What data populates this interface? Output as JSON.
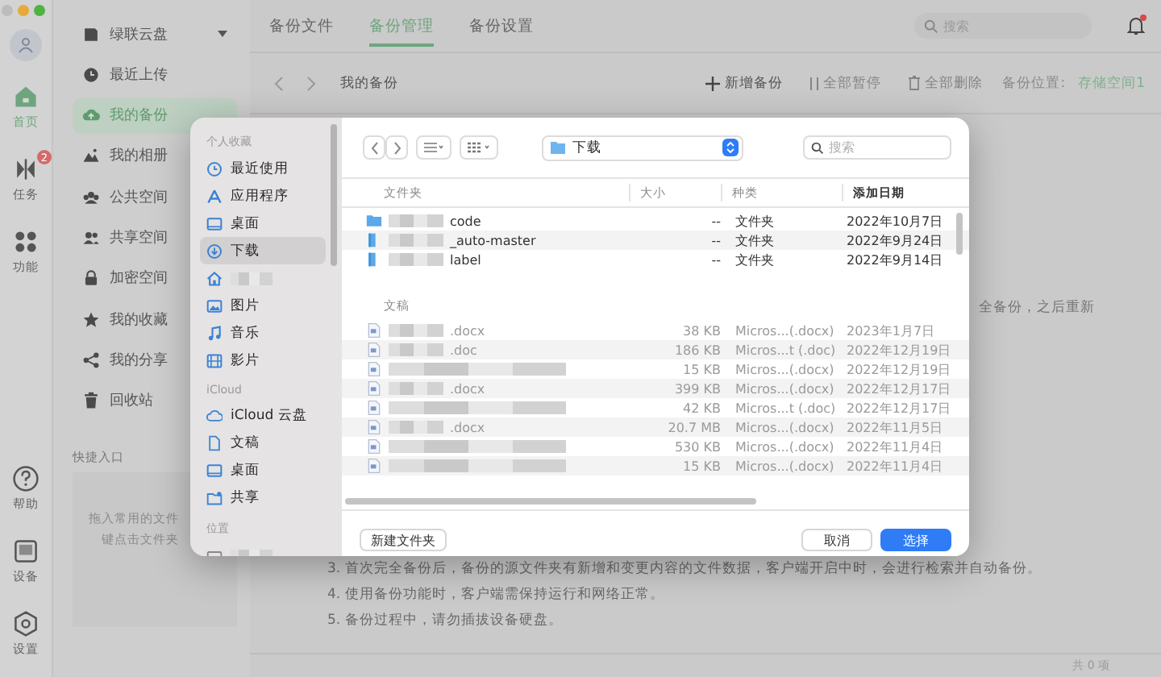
{
  "rail": {
    "items": [
      {
        "label": "首页",
        "kind": "home",
        "selected": true
      },
      {
        "label": "任务",
        "kind": "tasks",
        "badge": "2",
        "selected": false
      },
      {
        "label": "功能",
        "kind": "apps",
        "selected": false
      }
    ],
    "bottom": [
      {
        "label": "帮助",
        "kind": "help"
      },
      {
        "label": "设备",
        "kind": "device"
      },
      {
        "label": "设置",
        "kind": "settings"
      }
    ]
  },
  "sidebar": {
    "items": [
      {
        "label": "绿联云盘",
        "kind": "drive",
        "dropdown": true,
        "selected": false
      },
      {
        "label": "最近上传",
        "kind": "recent",
        "selected": false
      },
      {
        "label": "我的备份",
        "kind": "backup",
        "selected": true
      },
      {
        "label": "我的相册",
        "kind": "album",
        "selected": false
      },
      {
        "label": "公共空间",
        "kind": "public",
        "selected": false
      },
      {
        "label": "共享空间",
        "kind": "shared",
        "selected": false
      },
      {
        "label": "加密空间",
        "kind": "lock",
        "selected": false
      },
      {
        "label": "我的收藏",
        "kind": "star",
        "selected": false
      },
      {
        "label": "我的分享",
        "kind": "share",
        "selected": false
      },
      {
        "label": "回收站",
        "kind": "trash",
        "selected": false
      }
    ],
    "quick_access": {
      "title": "快捷入口",
      "hint_lines": [
        "拖入常用的文件",
        "键点击文件夹"
      ]
    }
  },
  "tabs": [
    {
      "label": "备份文件",
      "selected": false
    },
    {
      "label": "备份管理",
      "selected": true
    },
    {
      "label": "备份设置",
      "selected": false
    }
  ],
  "search": {
    "placeholder": "搜索"
  },
  "notifications": {
    "unread": true
  },
  "toolbar": {
    "breadcrumb": "我的备份",
    "actions": [
      {
        "label": "新增备份",
        "kind": "add",
        "disabled": false
      },
      {
        "label": "全部暂停",
        "kind": "pause",
        "disabled": true
      },
      {
        "label": "全部删除",
        "kind": "delete",
        "disabled": true
      }
    ],
    "location_label": "备份位置:",
    "location_value": "存储空间1"
  },
  "notes": {
    "fragment": "全备份，之后重新",
    "lines": [
      "3. 首次完全备份后，备份的源文件夹有新增和变更内容的文件数据，客户端开启中时，会进行检索并自动备份。",
      "4. 使用备份功能时，客户端需保持运行和网络正常。",
      "5. 备份过程中，请勿插拔设备硬盘。"
    ]
  },
  "footer": {
    "count": "共 0 项"
  },
  "dialog": {
    "sidebar": [
      {
        "title": "个人收藏",
        "items": [
          {
            "label": "最近使用",
            "kind": "recent",
            "selected": false
          },
          {
            "label": "应用程序",
            "kind": "apps",
            "selected": false
          },
          {
            "label": "桌面",
            "kind": "desktop",
            "selected": false
          },
          {
            "label": "下载",
            "kind": "download",
            "selected": true
          },
          {
            "kind": "home",
            "redacted": true,
            "selected": false
          },
          {
            "label": "图片",
            "kind": "pictures",
            "selected": false
          },
          {
            "label": "音乐",
            "kind": "music",
            "selected": false
          },
          {
            "label": "影片",
            "kind": "movies",
            "selected": false
          }
        ]
      },
      {
        "title": "iCloud",
        "items": [
          {
            "label": "iCloud 云盘",
            "kind": "cloud",
            "selected": false
          },
          {
            "label": "文稿",
            "kind": "document",
            "selected": false
          },
          {
            "label": "桌面",
            "kind": "desktop",
            "selected": false
          },
          {
            "label": "共享",
            "kind": "shared",
            "selected": false
          }
        ]
      },
      {
        "title": "位置",
        "items": [
          {
            "kind": "disk",
            "redacted": true,
            "selected": false
          }
        ]
      }
    ],
    "location": "下载",
    "search": {
      "placeholder": "搜索"
    },
    "columns": [
      {
        "label": "大小",
        "selected": false
      },
      {
        "label": "种类",
        "selected": false
      },
      {
        "label": "添加日期",
        "selected": true
      }
    ],
    "groups": [
      {
        "title": "文件夹",
        "rows": [
          {
            "name": "code",
            "size": "--",
            "type_text": "文件夹",
            "date": "2022年10月7日",
            "kind": "folder",
            "redacted": true,
            "disabled": false
          },
          {
            "name": "_auto-master",
            "size": "--",
            "type_text": "文件夹",
            "date": "2022年9月24日",
            "kind": "package",
            "redacted": true,
            "disabled": false
          },
          {
            "name": "label",
            "size": "--",
            "type_text": "文件夹",
            "date": "2022年9月14日",
            "kind": "package",
            "redacted": true,
            "disabled": false
          }
        ]
      },
      {
        "title": "文稿",
        "rows": [
          {
            "name": ".docx",
            "size": "38 KB",
            "type_text": "Micros...(.docx)",
            "date": "2023年1月7日",
            "kind": "doc",
            "redacted": true,
            "disabled": true
          },
          {
            "name": ".doc",
            "size": "186 KB",
            "type_text": "Micros...t (.doc)",
            "date": "2022年12月19日",
            "kind": "doc",
            "redacted": true,
            "disabled": true
          },
          {
            "size": "15 KB",
            "type_text": "Micros...(.docx)",
            "date": "2022年12月19日",
            "kind": "doc",
            "redacted": true,
            "disabled": true
          },
          {
            "name": ".docx",
            "size": "399 KB",
            "type_text": "Micros...(.docx)",
            "date": "2022年12月17日",
            "kind": "doc",
            "redacted": true,
            "disabled": true
          },
          {
            "size": "42 KB",
            "type_text": "Micros...t (.doc)",
            "date": "2022年12月17日",
            "kind": "doc",
            "redacted": true,
            "disabled": true
          },
          {
            "name": ".docx",
            "size": "20.7 MB",
            "type_text": "Micros...(.docx)",
            "date": "2022年11月5日",
            "kind": "doc",
            "redacted": true,
            "disabled": true
          },
          {
            "size": "530 KB",
            "type_text": "Micros...(.docx)",
            "date": "2022年11月4日",
            "kind": "doc",
            "redacted": true,
            "disabled": true
          },
          {
            "size": "15 KB",
            "type_text": "Micros...(.docx)",
            "date": "2022年11月4日",
            "kind": "doc",
            "redacted": true,
            "disabled": true
          }
        ]
      }
    ],
    "left_buttons": [
      {
        "label": "新建文件夹",
        "kind": "secondary"
      }
    ],
    "right_buttons": [
      {
        "label": "取消",
        "kind": "secondary"
      },
      {
        "label": "选择",
        "kind": "primary"
      }
    ]
  }
}
